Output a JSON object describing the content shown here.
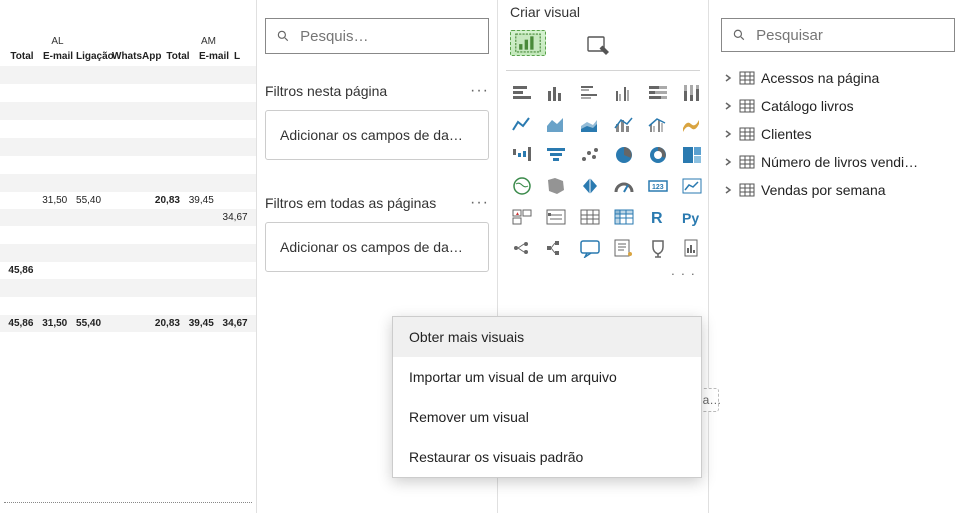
{
  "data_table": {
    "groups": [
      {
        "label": "AL",
        "cols": [
          "Total",
          "E-mail",
          "Ligação",
          "WhatsApp"
        ]
      },
      {
        "label": "AM",
        "cols": [
          "Total",
          "E-mail",
          "L"
        ]
      }
    ],
    "rows": [
      {
        "blank": true
      },
      {
        "blank": true
      },
      {
        "blank": true
      },
      {
        "blank": true
      },
      {
        "blank": true
      },
      {
        "blank": true
      },
      {
        "blank": true
      },
      {
        "values": [
          "",
          "31,50",
          "55,40",
          "",
          "20,83",
          "39,45",
          ""
        ]
      },
      {
        "values": [
          "",
          "",
          "",
          "",
          "",
          "",
          "34,67"
        ]
      },
      {
        "blank": true
      },
      {
        "blank": true
      },
      {
        "values": [
          "45,86",
          "",
          "",
          "",
          "",
          "",
          ""
        ],
        "bold0": true
      },
      {
        "blank": true
      },
      {
        "blank": true
      },
      {
        "values": [
          "45,86",
          "31,50",
          "55,40",
          "",
          "20,83",
          "39,45",
          "34,67"
        ],
        "boldAll": true
      }
    ]
  },
  "filters": {
    "search_placeholder": "Pesquis…",
    "section1_title": "Filtros nesta página",
    "section1_drop": "Adicionar os campos de da…",
    "section2_title": "Filtros em todas as páginas",
    "section2_drop": "Adicionar os campos de da…"
  },
  "visuals": {
    "title": "Criar visual",
    "icons": [
      "stacked-bar",
      "stacked-column",
      "clustered-bar",
      "clustered-column",
      "100-stacked-bar",
      "100-stacked-column",
      "line",
      "area",
      "stacked-area",
      "line-column",
      "line-clustered",
      "ribbon",
      "waterfall",
      "funnel",
      "scatter",
      "pie",
      "donut",
      "treemap",
      "map",
      "filled-map",
      "azure-map",
      "gauge",
      "card",
      "kpi",
      "multi-card",
      "slicer",
      "table",
      "matrix",
      "r-visual",
      "py-visual",
      "key-influencers",
      "decomposition",
      "qa",
      "narrative",
      "goals",
      "paginated"
    ],
    "context_menu": [
      "Obter mais visuais",
      "Importar um visual de um arquivo",
      "Remover um visual",
      "Restaurar os visuais padrão"
    ]
  },
  "fields": {
    "search_placeholder": "Pesquisar",
    "tables": [
      "Acessos na página",
      "Catálogo livros",
      "Clientes",
      "Número de livros vendi…",
      "Vendas por semana"
    ],
    "placeholder_snip": "la…"
  }
}
